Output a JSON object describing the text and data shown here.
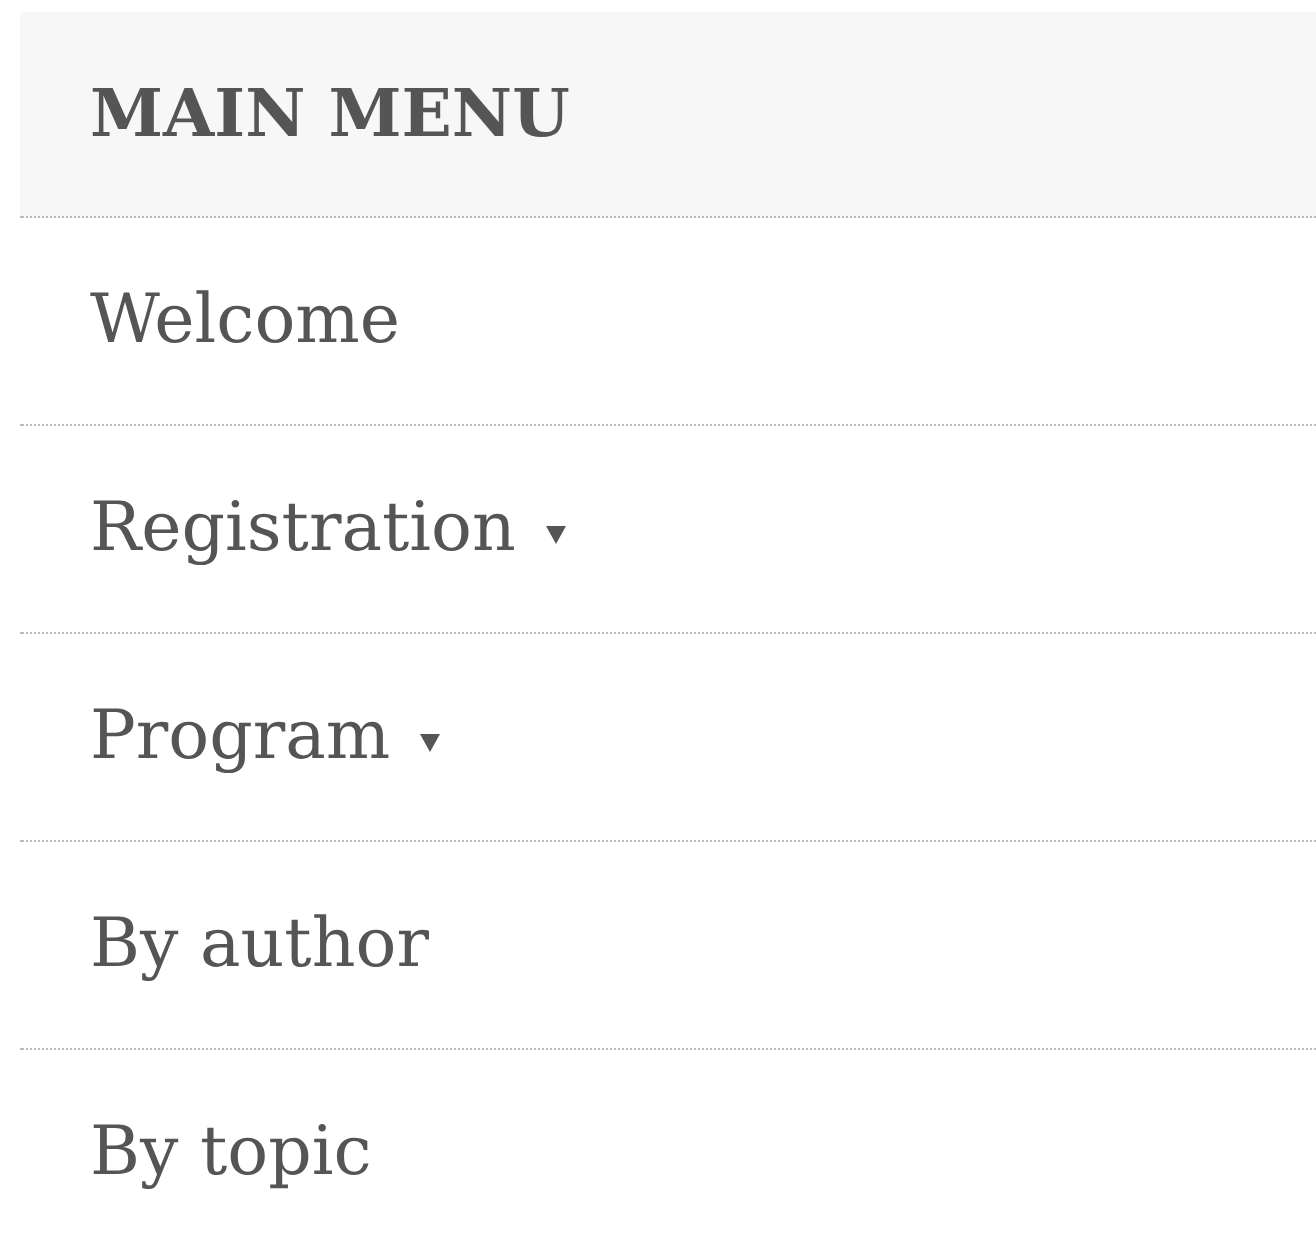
{
  "menu": {
    "title": "MAIN MENU",
    "items": [
      {
        "label": "Welcome",
        "has_submenu": false
      },
      {
        "label": "Registration",
        "has_submenu": true
      },
      {
        "label": "Program",
        "has_submenu": true
      },
      {
        "label": "By author",
        "has_submenu": false
      },
      {
        "label": "By topic",
        "has_submenu": false
      }
    ]
  }
}
